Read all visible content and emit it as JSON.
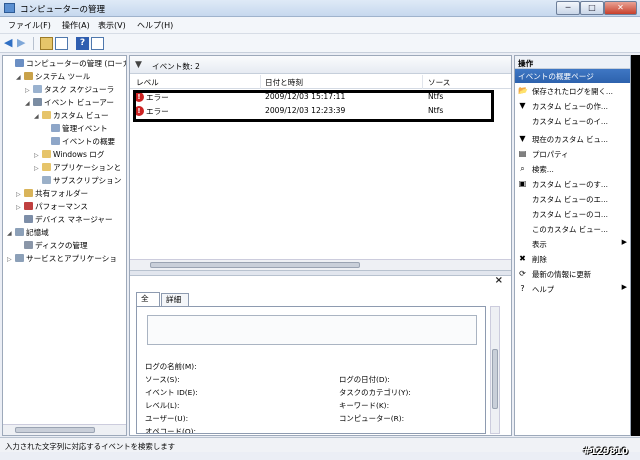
{
  "window": {
    "title": "コンピューターの管理",
    "min": "─",
    "max": "□",
    "close": "✕"
  },
  "menu": [
    "ファイル(F)",
    "操作(A)",
    "表示(V)",
    "ヘルプ(H)"
  ],
  "tree": [
    {
      "label": "コンピューターの管理 (ローカ",
      "icon": "computer-icon",
      "color": "#6b8fc4"
    },
    {
      "label": "システム ツール",
      "icon": "tools-icon",
      "color": "#c9a24a",
      "ex": "◢"
    },
    {
      "label": "タスク スケジューラ",
      "icon": "clock-icon",
      "color": "#9ab2cf",
      "ex": "▷"
    },
    {
      "label": "イベント ビューアー",
      "icon": "event-viewer-icon",
      "color": "#7b8da3",
      "ex": "◢"
    },
    {
      "label": "カスタム ビュー",
      "icon": "folder-icon",
      "color": "#e6c46a",
      "ex": "◢"
    },
    {
      "label": "管理イベント",
      "icon": "filter-icon",
      "color": "#8ea6c8"
    },
    {
      "label": "イベントの概要",
      "icon": "filter-icon",
      "color": "#8ea6c8"
    },
    {
      "label": "Windows ログ",
      "icon": "folder-icon",
      "color": "#e6c46a",
      "ex": "▷"
    },
    {
      "label": "アプリケーションと",
      "icon": "folder-icon",
      "color": "#e6c46a",
      "ex": "▷"
    },
    {
      "label": "サブスクリプション",
      "icon": "subscription-icon",
      "color": "#9bb0c8"
    },
    {
      "label": "共有フォルダー",
      "icon": "shared-folder-icon",
      "color": "#d9b45a",
      "ex": "▷"
    },
    {
      "label": "パフォーマンス",
      "icon": "performance-icon",
      "color": "#c04040",
      "ex": "▷"
    },
    {
      "label": "デバイス マネージャー",
      "icon": "device-manager-icon",
      "color": "#7d8ea8"
    },
    {
      "label": "記憶域",
      "icon": "storage-icon",
      "color": "#8ca0b8",
      "ex": "◢"
    },
    {
      "label": "ディスクの管理",
      "icon": "disk-icon",
      "color": "#8a96a8"
    },
    {
      "label": "サービスとアプリケーショ",
      "icon": "services-icon",
      "color": "#8ca0b8",
      "ex": "▷"
    }
  ],
  "center": {
    "event_count": "イベント数: 2",
    "columns": [
      "レベル",
      "日付と時刻",
      "ソース"
    ],
    "rows": [
      {
        "level": "エラー",
        "datetime": "2009/12/03 15:17:11",
        "source": "Ntfs"
      },
      {
        "level": "エラー",
        "datetime": "2009/12/03 12:23:39",
        "source": "Ntfs"
      }
    ]
  },
  "detail": {
    "close": "×",
    "tabs": [
      "全般",
      "詳細"
    ],
    "fields_left": [
      "ログの名前(M):",
      "ソース(S):",
      "イベント ID(E):",
      "レベル(L):",
      "ユーザー(U):",
      "オペコード(O):"
    ],
    "fields_right": [
      "ログの日付(D):",
      "タスクのカテゴリ(Y):",
      "キーワード(K):",
      "コンピューター(R):"
    ]
  },
  "actions": {
    "header": "操作",
    "section": "イベントの概要ページ",
    "items": [
      {
        "label": "保存されたログを開く...",
        "icon": "open-log-icon",
        "glyph": "📂"
      },
      {
        "label": "カスタム ビューの作...",
        "icon": "create-view-icon",
        "glyph": "▼"
      },
      {
        "label": "カスタム ビューのイ...",
        "icon": "import-view-icon",
        "glyph": ""
      },
      {
        "label": "現在のカスタム ビュ...",
        "icon": "filter-icon",
        "glyph": "▼"
      },
      {
        "label": "プロパティ",
        "icon": "properties-icon",
        "glyph": "▤"
      },
      {
        "label": "検索...",
        "icon": "find-icon",
        "glyph": "⌕"
      },
      {
        "label": "カスタム ビューのす...",
        "icon": "save-icon",
        "glyph": "▣"
      },
      {
        "label": "カスタム ビューのエ...",
        "icon": "export-icon",
        "glyph": ""
      },
      {
        "label": "カスタム ビューのコ...",
        "icon": "copy-icon",
        "glyph": ""
      },
      {
        "label": "このカスタム ビュー...",
        "icon": "attach-icon",
        "glyph": ""
      },
      {
        "label": "表示",
        "icon": "view-icon",
        "glyph": "",
        "arrow": "▶"
      },
      {
        "label": "削除",
        "icon": "delete-icon",
        "glyph": "✖"
      },
      {
        "label": "最新の情報に更新",
        "icon": "refresh-icon",
        "glyph": "⟳"
      },
      {
        "label": "ヘルプ",
        "icon": "help-icon",
        "glyph": "?",
        "arrow": "▶"
      }
    ]
  },
  "status": "入力された文字列に対応するイベントを検索します",
  "watermark": "#129810"
}
